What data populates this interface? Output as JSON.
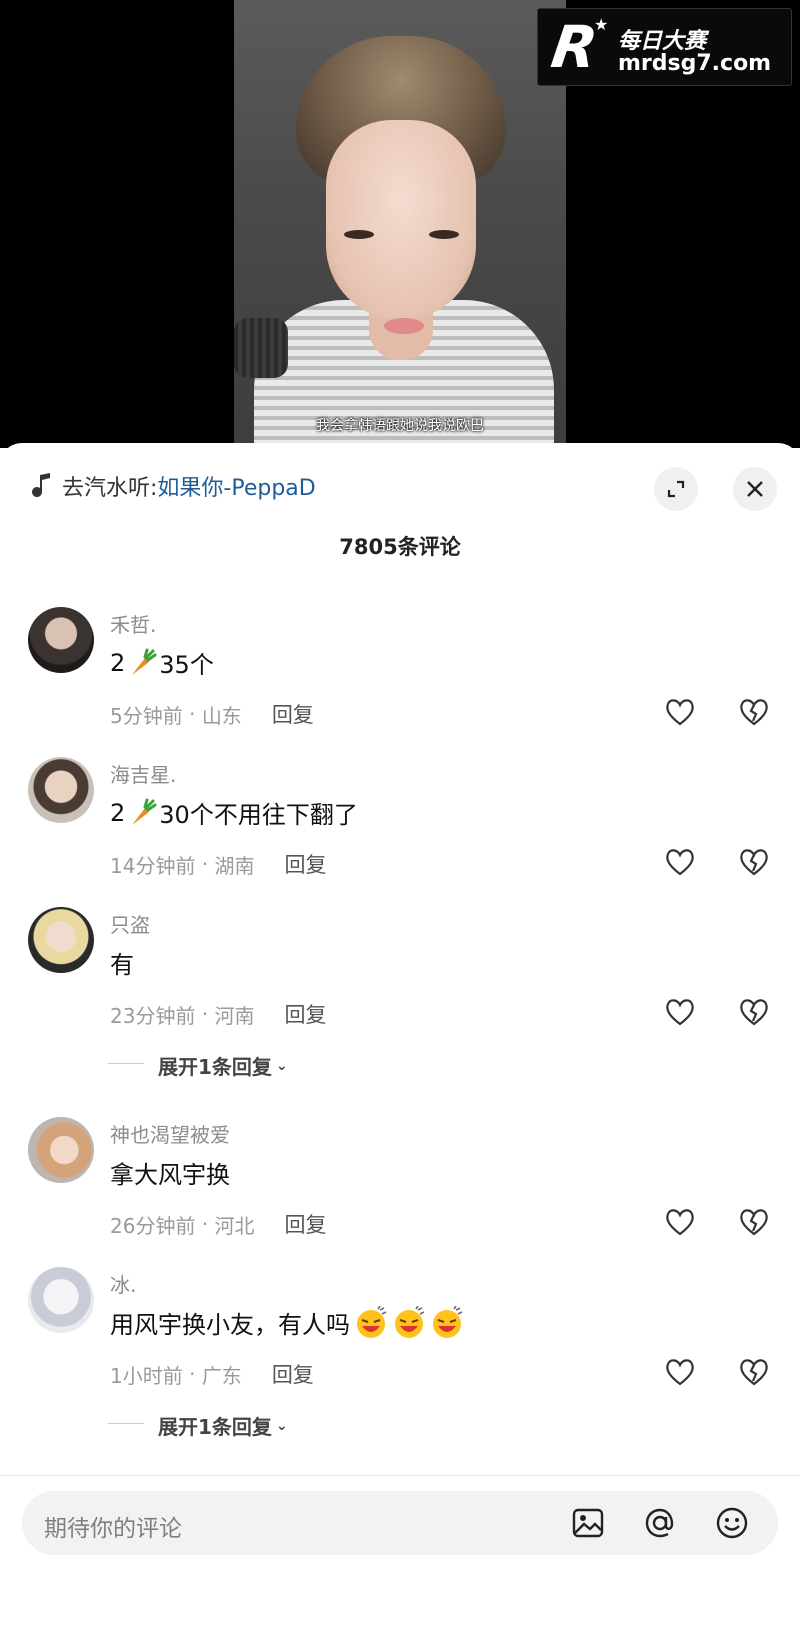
{
  "video": {
    "subtitle": "我会拿韩语跟她说我说欧巴"
  },
  "watermark": {
    "logo_letter": "R",
    "brand_cn": "每日大赛",
    "url": "mrdsg7.com"
  },
  "music": {
    "icon": "music-note-icon",
    "prefix": "去汽水听:",
    "title": "如果你-PeppaD"
  },
  "header_buttons": {
    "expand_icon": "expand-icon",
    "close_icon": "close-icon"
  },
  "comment_count": "7805条评论",
  "comments": [
    {
      "username": "禾哲.",
      "text_before": "2",
      "emoji": "carrot",
      "text_after": "35个",
      "time": "5分钟前",
      "location": "山东",
      "reply_label": "回复"
    },
    {
      "username": "海吉星.",
      "text_before": "2",
      "emoji": "carrot",
      "text_after": "30个不用往下翻了",
      "time": "14分钟前",
      "location": "湖南",
      "reply_label": "回复"
    },
    {
      "username": "只盗",
      "text_before": "有",
      "time": "23分钟前",
      "location": "河南",
      "reply_label": "回复",
      "expand_label": "展开1条回复"
    },
    {
      "username": "神也渴望被爱",
      "text_before": "拿大风宇换",
      "time": "26分钟前",
      "location": "河北",
      "reply_label": "回复"
    },
    {
      "username": "冰.",
      "text_before": "用风宇换小友，有人吗",
      "emoji": "laughing-face x3",
      "time": "1小时前",
      "location": "广东",
      "reply_label": "回复",
      "expand_label": "展开1条回复"
    }
  ],
  "input": {
    "placeholder": "期待你的评论",
    "icons": [
      "image-icon",
      "at-icon",
      "smile-icon"
    ]
  },
  "colors": {
    "link_blue": "#1f5c99",
    "meta_gray": "#9a9a9a",
    "sheet_bg": "#ffffff",
    "input_bg": "#f2f2f4"
  }
}
